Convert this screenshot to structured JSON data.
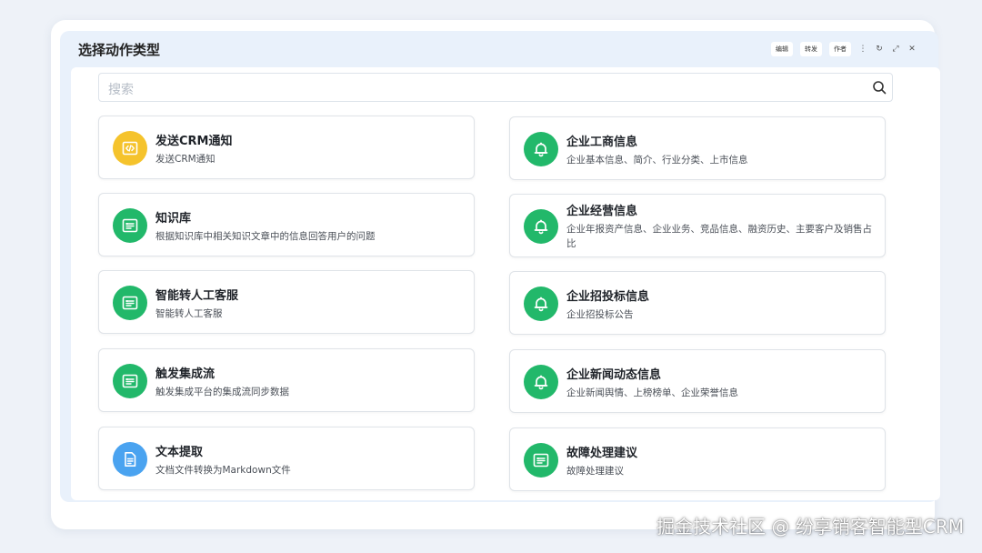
{
  "dialog": {
    "title": "选择动作类型"
  },
  "window_controls": {
    "edit": "编辑",
    "forward": "转发",
    "author": "作者"
  },
  "search": {
    "placeholder": "搜索"
  },
  "colors": {
    "yellow": "#f5c32c",
    "green": "#22b86a",
    "blue": "#4aa3f0"
  },
  "cards_left": [
    {
      "title": "发送CRM通知",
      "desc": "发送CRM通知",
      "icon": "code-icon",
      "color": "yellow"
    },
    {
      "title": "知识库",
      "desc": "根据知识库中相关知识文章中的信息回答用户的问题",
      "icon": "form-icon",
      "color": "green"
    },
    {
      "title": "智能转人工客服",
      "desc": "智能转人工客服",
      "icon": "form-icon",
      "color": "green"
    },
    {
      "title": "触发集成流",
      "desc": "触发集成平台的集成流同步数据",
      "icon": "form-icon",
      "color": "green"
    },
    {
      "title": "文本提取",
      "desc": "文档文件转换为Markdown文件",
      "icon": "document-icon",
      "color": "blue"
    }
  ],
  "cards_right": [
    {
      "title": "企业工商信息",
      "desc": "企业基本信息、简介、行业分类、上市信息",
      "icon": "bell-icon",
      "color": "green"
    },
    {
      "title": "企业经营信息",
      "desc": "企业年报资产信息、企业业务、竞品信息、融资历史、主要客户及销售占比",
      "icon": "bell-icon",
      "color": "green"
    },
    {
      "title": "企业招投标信息",
      "desc": "企业招投标公告",
      "icon": "bell-icon",
      "color": "green"
    },
    {
      "title": "企业新闻动态信息",
      "desc": "企业新闻舆情、上榜榜单、企业荣誉信息",
      "icon": "bell-icon",
      "color": "green"
    },
    {
      "title": "故障处理建议",
      "desc": "故障处理建议",
      "icon": "form-icon",
      "color": "green"
    }
  ],
  "watermark": "掘金技术社区 @ 纷享销客智能型CRM"
}
